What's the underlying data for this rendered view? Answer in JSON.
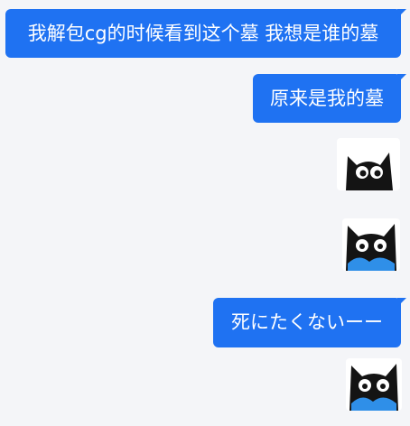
{
  "messages": [
    {
      "type": "text",
      "text": "我解包cg的时候看到这个墓 我想是谁的墓"
    },
    {
      "type": "text",
      "text": "原来是我的墓"
    },
    {
      "type": "sticker",
      "icon": "black-cat-sticker-icon"
    },
    {
      "type": "sticker",
      "icon": "crying-black-cat-sticker-icon"
    },
    {
      "type": "text",
      "text": "死にたくないーー"
    },
    {
      "type": "sticker",
      "icon": "crying-black-cat-sticker-icon"
    }
  ],
  "colors": {
    "background": "#f4f5f8",
    "bubble": "#1f72f2",
    "bubble_text": "#ffffff",
    "cat": "#141414",
    "tears": "#2f8fe8"
  }
}
